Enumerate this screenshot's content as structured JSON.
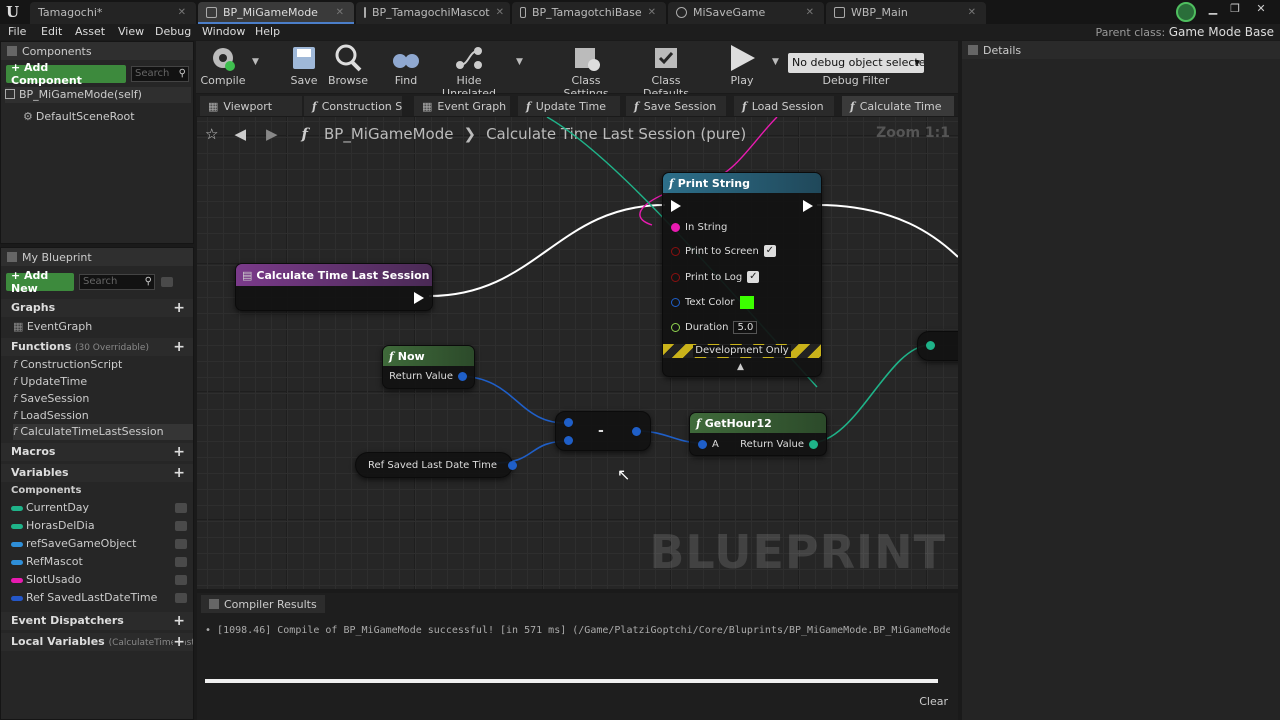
{
  "window_tabs": [
    {
      "label": "Tamagochi*"
    },
    {
      "label": "BP_MiGameMode"
    },
    {
      "label": "BP_TamagochiMascot"
    },
    {
      "label": "BP_TamagotchiBase"
    },
    {
      "label": "MiSaveGame"
    },
    {
      "label": "WBP_Main"
    }
  ],
  "menu": [
    "File",
    "Edit",
    "Asset",
    "View",
    "Debug",
    "Window",
    "Help"
  ],
  "parent_class": {
    "label": "Parent class:",
    "value": "Game Mode Base"
  },
  "components_panel": {
    "title": "Components",
    "add_button": "+ Add Component",
    "search_placeholder": "Search",
    "self_label": "BP_MiGameMode(self)",
    "children": [
      "DefaultSceneRoot"
    ]
  },
  "my_blueprint": {
    "title": "My Blueprint",
    "add_new": "+ Add New",
    "search_placeholder": "Search",
    "graphs": {
      "title": "Graphs",
      "items": [
        "EventGraph"
      ]
    },
    "functions": {
      "title": "Functions",
      "note": "(30 Overridable)",
      "items": [
        "ConstructionScript",
        "UpdateTime",
        "SaveSession",
        "LoadSession",
        "CalculateTimeLastSession"
      ]
    },
    "macros": {
      "title": "Macros"
    },
    "variables": {
      "title": "Variables",
      "group": "Components",
      "items": [
        {
          "name": "CurrentDay",
          "color": "#1fb389"
        },
        {
          "name": "HorasDelDia",
          "color": "#1fb389"
        },
        {
          "name": "refSaveGameObject",
          "color": "#2f8fd8"
        },
        {
          "name": "RefMascot",
          "color": "#2f8fd8"
        },
        {
          "name": "SlotUsado",
          "color": "#e81bb0"
        },
        {
          "name": "Ref SavedLastDateTime",
          "color": "#2457c8"
        }
      ]
    },
    "event_dispatchers": {
      "title": "Event Dispatchers"
    },
    "local_variables": {
      "title": "Local Variables",
      "note": "(CalculateTimeLastS"
    }
  },
  "toolbar": {
    "compile": "Compile",
    "save": "Save",
    "browse": "Browse",
    "find": "Find",
    "hide_unrelated": "Hide Unrelated",
    "class_settings": "Class Settings",
    "class_defaults": "Class Defaults",
    "play": "Play",
    "debug_select": "No debug object selected",
    "debug_filter": "Debug Filter"
  },
  "graph_tabs": [
    "Viewport",
    "Construction S",
    "Event Graph",
    "Update Time",
    "Save Session",
    "Load Session",
    "Calculate Time"
  ],
  "breadcrumb": {
    "blueprint": "BP_MiGameMode",
    "function": "Calculate Time Last Session (pure)"
  },
  "zoom": "Zoom 1:1",
  "nodes": {
    "entry": {
      "title": "Calculate Time Last Session"
    },
    "print_string": {
      "title": "Print String",
      "in_string": "In String",
      "print_to_screen": "Print to Screen",
      "print_to_log": "Print to Log",
      "text_color": "Text Color",
      "text_color_value": "#3cff00",
      "duration": "Duration",
      "duration_value": "5.0",
      "dev_only": "Development Only"
    },
    "now": {
      "title": "Now",
      "return": "Return Value"
    },
    "ref_saved": {
      "title": "Ref Saved Last Date Time"
    },
    "subtract": {
      "symbol": "-"
    },
    "get_hour": {
      "title": "GetHour12",
      "a": "A",
      "return": "Return Value"
    }
  },
  "watermark": "BLUEPRINT",
  "details": {
    "title": "Details"
  },
  "compiler": {
    "title": "Compiler Results",
    "log": "[1098.46] Compile of BP_MiGameMode successful! [in 571 ms] (/Game/PlatziGoptchi/Core/Bluprints/BP_MiGameMode.BP_MiGameMode",
    "clear": "Clear"
  }
}
